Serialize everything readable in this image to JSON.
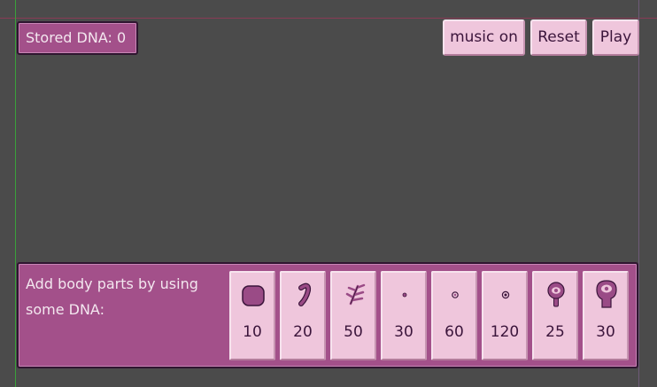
{
  "stored_dna": {
    "label": "Stored DNA: 0"
  },
  "buttons": {
    "music": "music on",
    "reset": "Reset",
    "play": "Play"
  },
  "panel": {
    "text": "Add body parts by using some DNA:"
  },
  "parts": [
    {
      "icon": "blob-icon",
      "cost": "10"
    },
    {
      "icon": "tail-icon",
      "cost": "20"
    },
    {
      "icon": "cilia-icon",
      "cost": "50"
    },
    {
      "icon": "small-dot-icon",
      "cost": "30"
    },
    {
      "icon": "ring-dot-icon",
      "cost": "60"
    },
    {
      "icon": "eye-dot-icon",
      "cost": "120"
    },
    {
      "icon": "eye-stalk-icon",
      "cost": "25"
    },
    {
      "icon": "big-eye-icon",
      "cost": "30"
    }
  ],
  "colors": {
    "background": "#4b4b4b",
    "panel": "#a3508a",
    "button": "#efc6dc",
    "icon": "#9a4b86",
    "text_dark": "#3b153b"
  }
}
